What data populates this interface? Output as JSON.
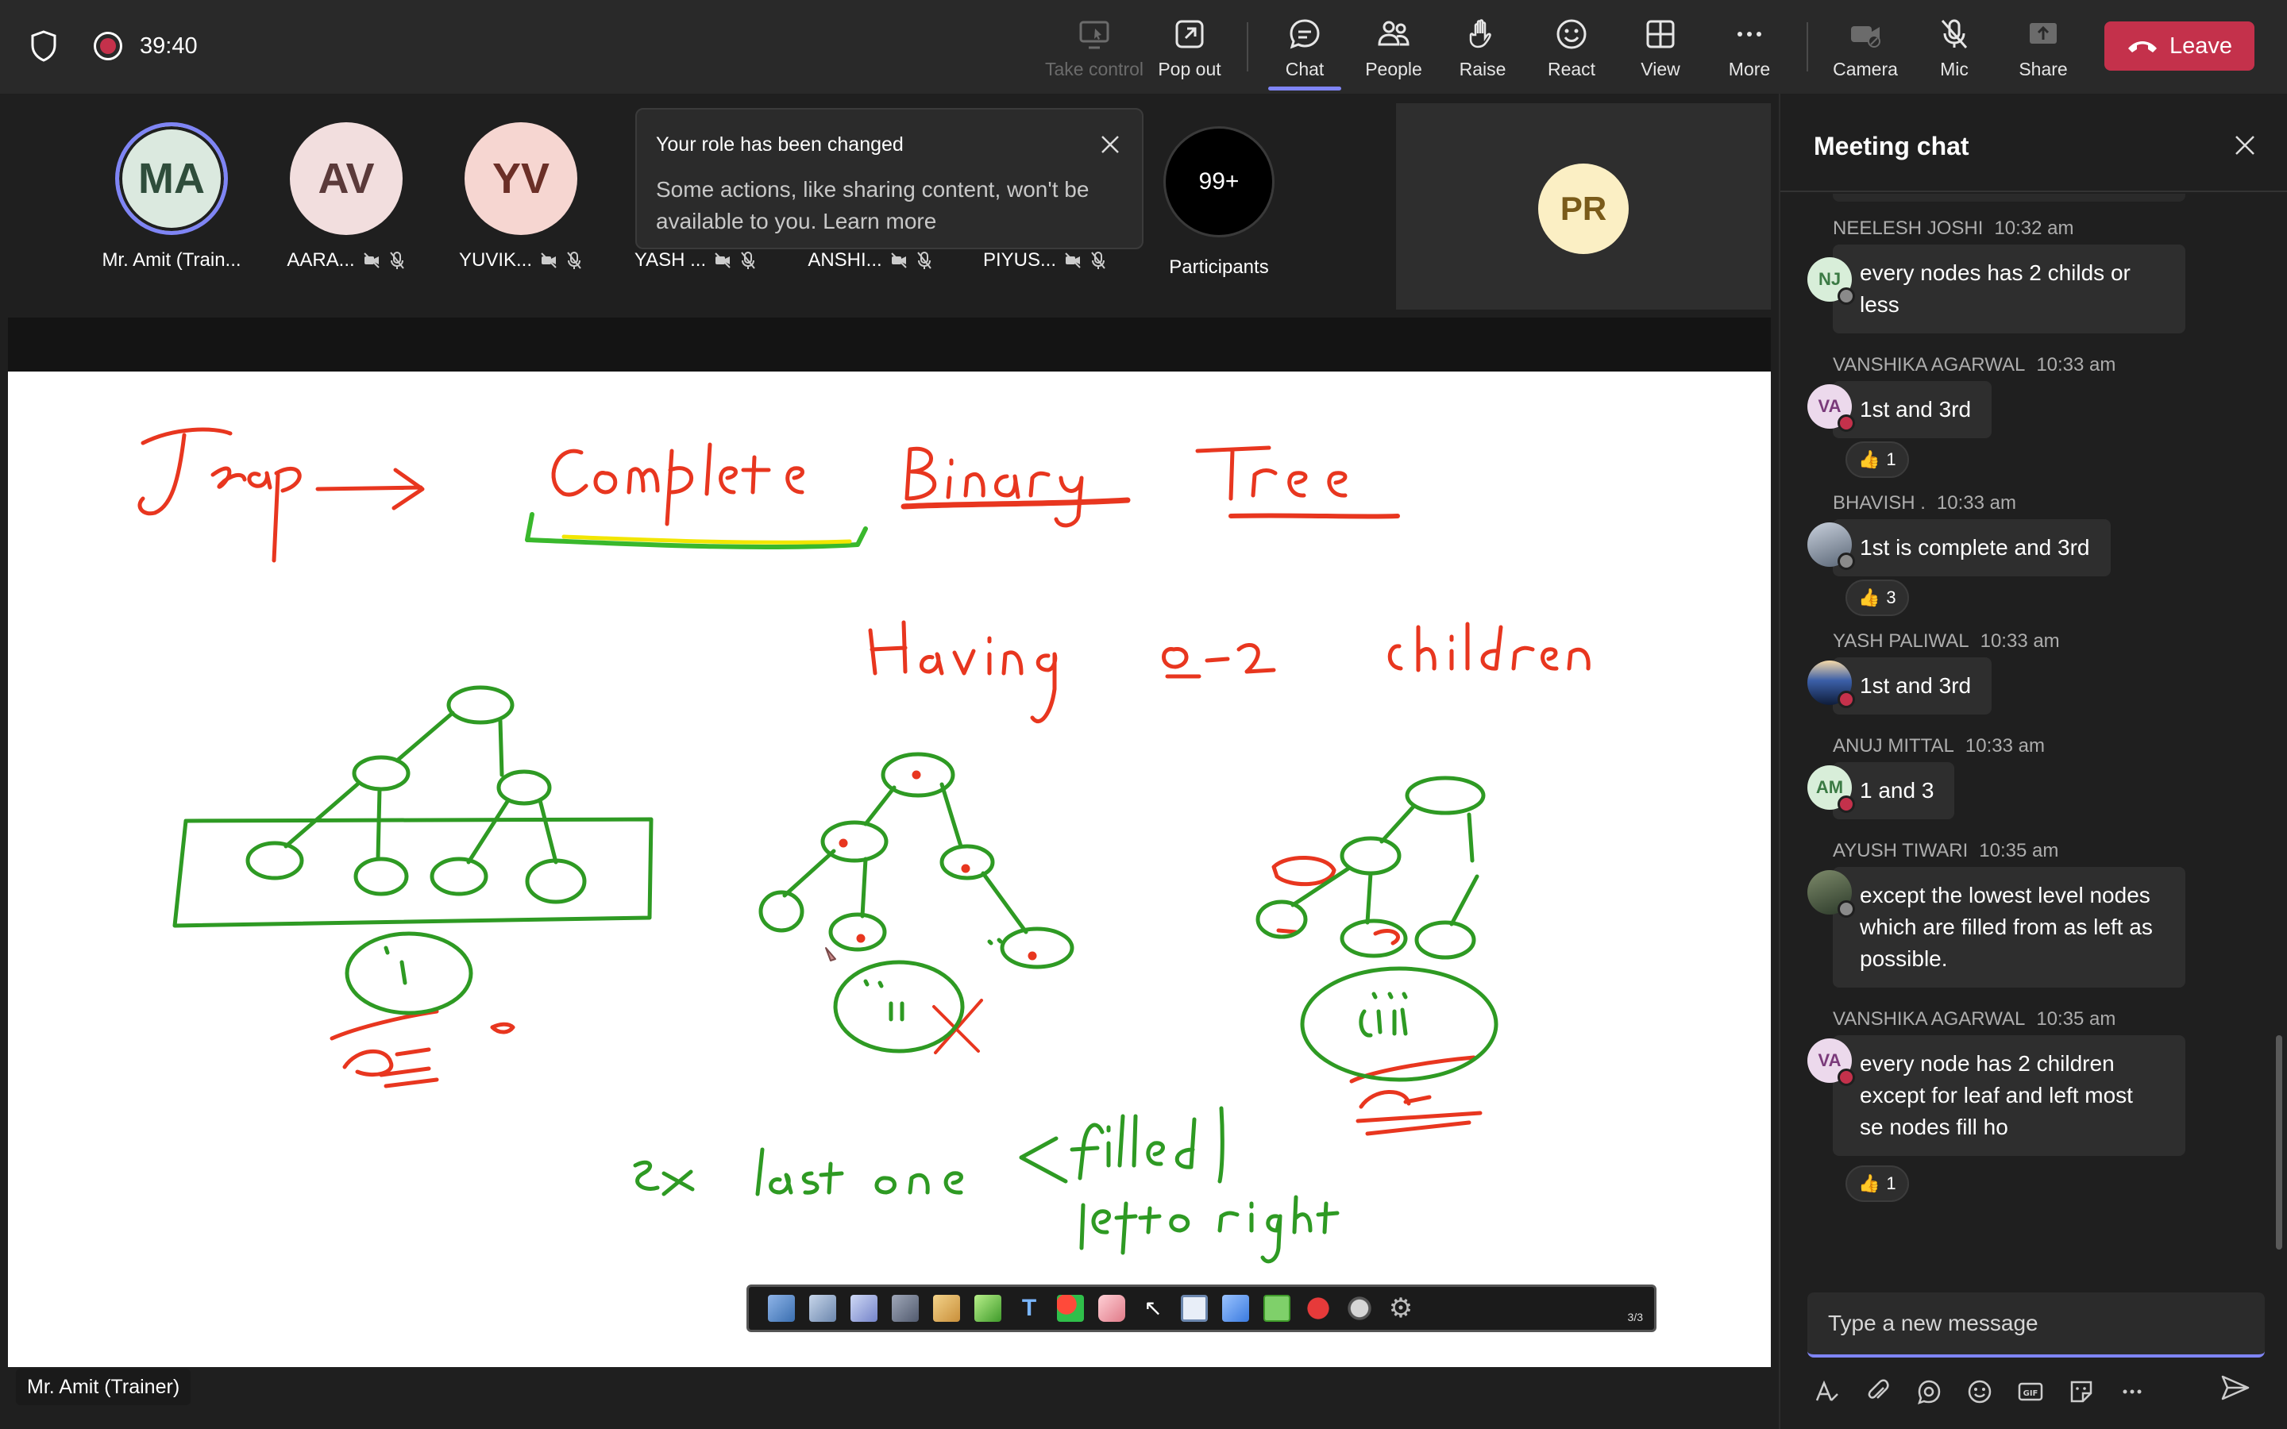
{
  "topbar": {
    "timer": "39:40",
    "buttons": {
      "take_control": "Take control",
      "pop_out": "Pop out",
      "chat": "Chat",
      "people": "People",
      "raise": "Raise",
      "react": "React",
      "view": "View",
      "more": "More",
      "camera": "Camera",
      "mic": "Mic",
      "share": "Share"
    },
    "leave_label": "Leave"
  },
  "participants": {
    "tiles": [
      {
        "initials": "MA",
        "name": "Mr. Amit (Train...",
        "color": "#dbe9df",
        "ring": "#7f85f5"
      },
      {
        "initials": "AV",
        "name": "AARA...",
        "color": "#f2dede"
      },
      {
        "initials": "YV",
        "name": "YUVIK...",
        "color": "#f6d6d1"
      },
      {
        "name": "YASH ..."
      },
      {
        "name": "ANSHI..."
      },
      {
        "name": "PIYUS..."
      }
    ],
    "count": "99+",
    "count_label": "Participants",
    "spotlight_initials": "PR"
  },
  "role_toast": {
    "title": "Your role has been changed",
    "body": "Some actions, like sharing content, won't be available to you. Learn more"
  },
  "whiteboard": {
    "page": "3/3"
  },
  "speaker_label": "Mr. Amit (Trainer)",
  "chat": {
    "title": "Meeting chat",
    "messages": [
      {
        "author": "NEELESH JOSHI",
        "time": "10:32 am",
        "initials": "NJ",
        "lines": [
          "every nodes has 2 childs or",
          "less"
        ]
      },
      {
        "author": "VANSHIKA AGARWAL",
        "time": "10:33 am",
        "initials": "VA",
        "lines": [
          "1st and 3rd"
        ],
        "reaction": "1"
      },
      {
        "author": "BHAVISH .",
        "time": "10:33 am",
        "initials": "",
        "lines": [
          "1st is complete and 3rd"
        ],
        "reaction": "3"
      },
      {
        "author": "YASH PALIWAL",
        "time": "10:33 am",
        "initials": "",
        "lines": [
          "1st and 3rd"
        ]
      },
      {
        "author": "ANUJ MITTAL",
        "time": "10:33 am",
        "initials": "AM",
        "lines": [
          "1 and 3"
        ]
      },
      {
        "author": "AYUSH TIWARI",
        "time": "10:35 am",
        "initials": "",
        "lines": [
          "except the lowest level nodes",
          "which are filled from as left as",
          "possible."
        ]
      },
      {
        "author": "VANSHIKA AGARWAL",
        "time": "10:35 am",
        "initials": "VA",
        "lines": [
          "every node has 2 children",
          "except for leaf and left most",
          "se nodes fill ho"
        ],
        "reaction": "1"
      }
    ],
    "composer_placeholder": "Type a new message"
  },
  "colors": {
    "accent": "#7f85f5",
    "leave": "#c4314b",
    "ink_red": "#e8361f",
    "ink_green": "#2e9a23"
  }
}
